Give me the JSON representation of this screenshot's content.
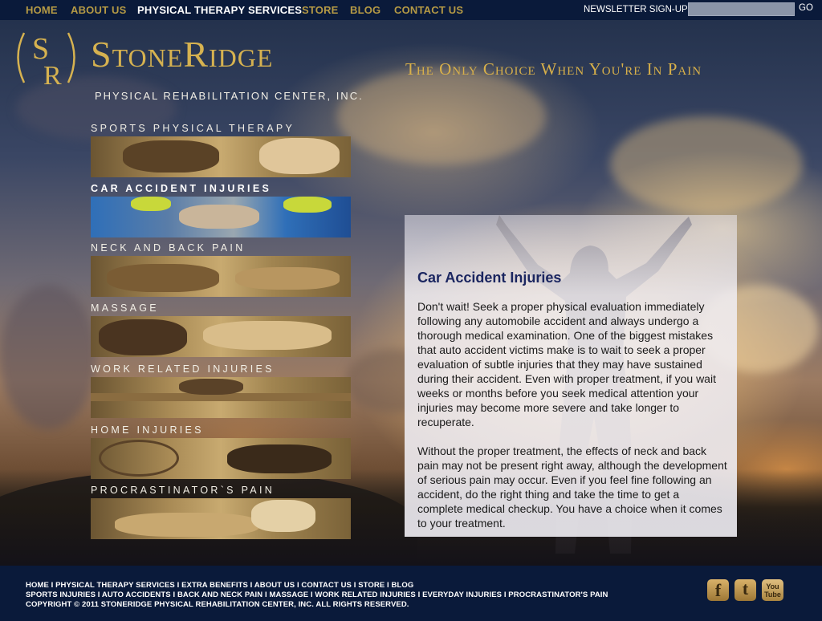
{
  "topnav": {
    "items": [
      {
        "label": "HOME"
      },
      {
        "label": "ABOUT US"
      },
      {
        "label": "PHYSICAL THERAPY SERVICES",
        "active": true
      },
      {
        "label": "STORE"
      },
      {
        "label": "BLOG"
      },
      {
        "label": "CONTACT US"
      }
    ],
    "newsletter_label": "NEWSLETTER SIGN-UP",
    "newsletter_placeholder": "",
    "go_label": "GO"
  },
  "logo": {
    "monogram": "SR",
    "title": "StoneRidge",
    "subtitle": "PHYSICAL REHABILITATION CENTER, INC."
  },
  "tagline": "The Only Choice When You're In Pain",
  "categories": [
    {
      "label": "SPORTS PHYSICAL THERAPY"
    },
    {
      "label": "CAR ACCIDENT INJURIES",
      "active": true
    },
    {
      "label": "NECK AND BACK PAIN"
    },
    {
      "label": "MASSAGE"
    },
    {
      "label": "WORK RELATED INJURIES"
    },
    {
      "label": "HOME INJURIES"
    },
    {
      "label": "PROCRASTINATOR`S PAIN"
    }
  ],
  "content": {
    "title": "Car Accident Injuries",
    "paragraphs": [
      "Don't wait! Seek a proper physical evaluation immediately following any automobile accident and always undergo a thorough medical examination. One of the biggest mistakes that auto accident victims make is to wait to seek a proper evaluation of subtle injuries that they may have sustained during their accident. Even with proper treatment, if you wait weeks or months before you seek medical attention your injuries may become more severe and take longer to recuperate.",
      "Without the proper treatment, the effects of neck and back pain may not be present right away, although the development of serious pain may occur. Even if you feel fine following an accident, do the right thing and take the time to get a complete medical checkup. You have a choice when it comes to your treatment."
    ]
  },
  "footer": {
    "line1": "HOME I PHYSICAL THERAPY SERVICES I EXTRA BENEFITS I ABOUT US I CONTACT US I STORE I BLOG",
    "line2": "SPORTS INJURIES I AUTO ACCIDENTS I BACK AND NECK PAIN I MASSAGE I WORK RELATED INJURIES I EVERYDAY INJURIES I PROCRASTINATOR'S PAIN",
    "line3": "COPYRIGHT © 2011 STONERIDGE PHYSICAL REHABILITATION CENTER, INC. ALL RIGHTS RESERVED.",
    "social": [
      {
        "icon": "facebook-icon",
        "glyph": "f"
      },
      {
        "icon": "twitter-icon",
        "glyph": "t"
      },
      {
        "icon": "youtube-icon",
        "glyph": "You Tube"
      }
    ]
  },
  "colors": {
    "nav_bg": "#0a1a3a",
    "gold": "#b59a45",
    "title_blue": "#1b2660"
  }
}
